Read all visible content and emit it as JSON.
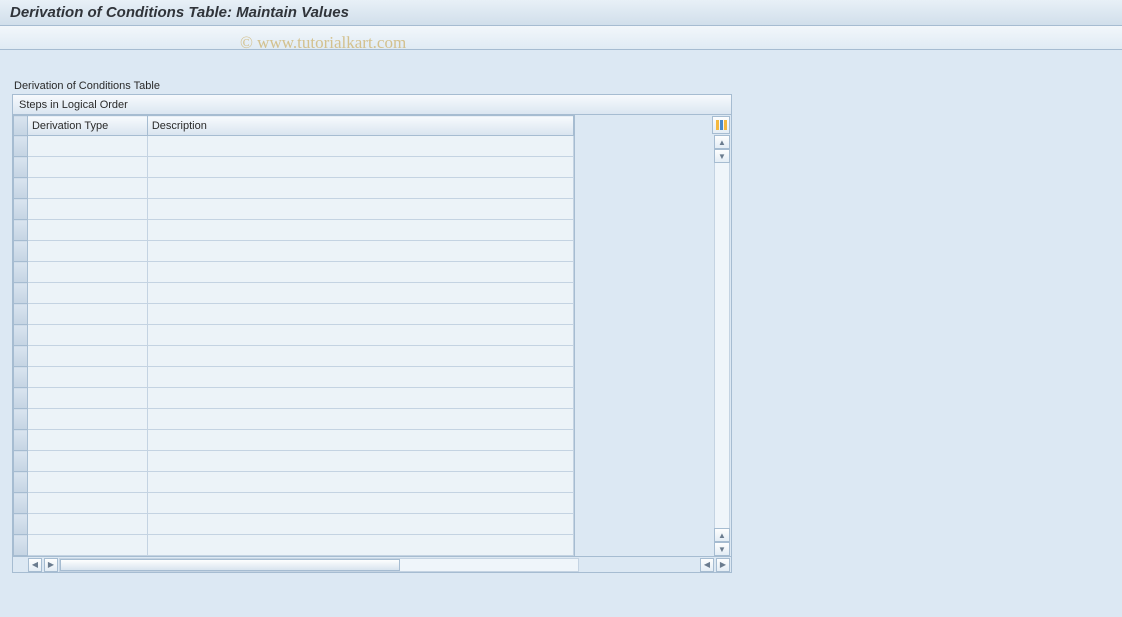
{
  "title": "Derivation of Conditions Table: Maintain Values",
  "section_label": "Derivation of Conditions Table",
  "panel_header": "Steps in Logical Order",
  "columns": {
    "derivation_type": "Derivation Type",
    "description": "Description"
  },
  "rows": [
    {
      "derivation_type": "",
      "description": ""
    },
    {
      "derivation_type": "",
      "description": ""
    },
    {
      "derivation_type": "",
      "description": ""
    },
    {
      "derivation_type": "",
      "description": ""
    },
    {
      "derivation_type": "",
      "description": ""
    },
    {
      "derivation_type": "",
      "description": ""
    },
    {
      "derivation_type": "",
      "description": ""
    },
    {
      "derivation_type": "",
      "description": ""
    },
    {
      "derivation_type": "",
      "description": ""
    },
    {
      "derivation_type": "",
      "description": ""
    },
    {
      "derivation_type": "",
      "description": ""
    },
    {
      "derivation_type": "",
      "description": ""
    },
    {
      "derivation_type": "",
      "description": ""
    },
    {
      "derivation_type": "",
      "description": ""
    },
    {
      "derivation_type": "",
      "description": ""
    },
    {
      "derivation_type": "",
      "description": ""
    },
    {
      "derivation_type": "",
      "description": ""
    },
    {
      "derivation_type": "",
      "description": ""
    },
    {
      "derivation_type": "",
      "description": ""
    },
    {
      "derivation_type": "",
      "description": ""
    }
  ],
  "watermark": "© www.tutorialkart.com"
}
